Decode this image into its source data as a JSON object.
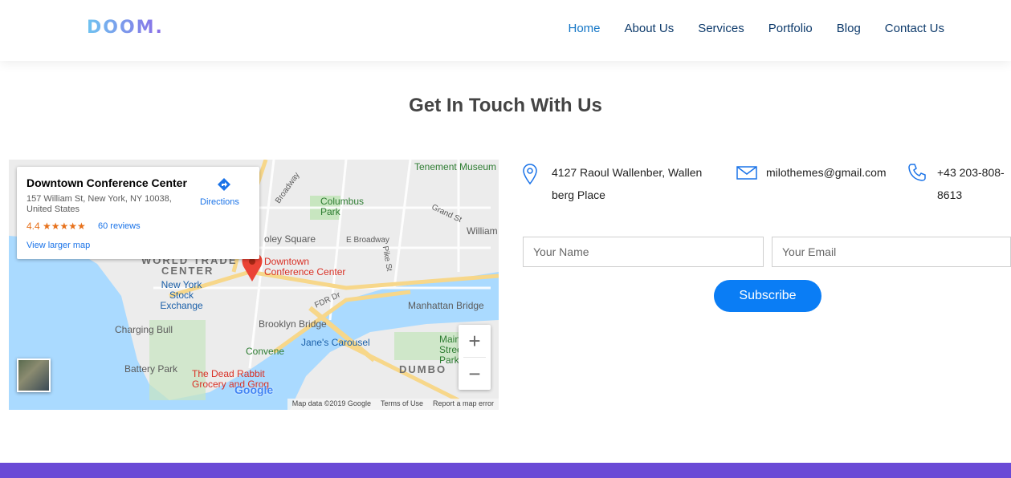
{
  "header": {
    "logo_text": "DOOM.",
    "nav": [
      {
        "label": "Home",
        "active": true
      },
      {
        "label": "About Us",
        "active": false
      },
      {
        "label": "Services",
        "active": false
      },
      {
        "label": "Portfolio",
        "active": false
      },
      {
        "label": "Blog",
        "active": false
      },
      {
        "label": "Contact Us",
        "active": false
      }
    ]
  },
  "section_title": "Get In Touch With Us",
  "map": {
    "card": {
      "name": "Downtown Conference Center",
      "address": "157 William St, New York, NY 10038, United States",
      "rating": "4.4 ★★★★★",
      "reviews": "60 reviews",
      "larger_map": "View larger map",
      "directions": "Directions"
    },
    "labels": {
      "tenement": "Tenement Museum",
      "columbus": "Columbus Park",
      "grand_st": "Grand St",
      "william": "William",
      "foley": "oley Square",
      "e_broadway": "E Broadway",
      "pike": "Pike St",
      "broadway": "Broadway",
      "world_trade": "WORLD TRADE",
      "center": "CENTER",
      "downtown": "Downtown Conference Center",
      "nyse": "New York Stock Exchange",
      "fdr": "FDR Dr",
      "manhattan_bridge": "Manhattan Bridge",
      "charging_bull": "Charging Bull",
      "brooklyn_bridge": "Brooklyn Bridge",
      "janes": "Jane's Carousel",
      "main_street": "Main Street Park",
      "convene": "Convene",
      "battery": "Battery Park",
      "dead_rabbit": "The Dead Rabbit Grocery and Grog",
      "dumbo": "DUMBO"
    },
    "zoom_in": "+",
    "zoom_out": "−",
    "google": "Google",
    "footer": [
      "Map data ©2019 Google",
      "Terms of Use",
      "Report a map error"
    ]
  },
  "contact": {
    "address_line1": "4127 Raoul Wallenber, Wallen",
    "address_line2": "berg Place",
    "email": "milothemes@gmail.com",
    "phone_line1": "+43 203-808-",
    "phone_line2": "8613"
  },
  "form": {
    "name_placeholder": "Your Name",
    "email_placeholder": "Your Email",
    "submit_label": "Subscribe"
  },
  "colors": {
    "accent": "#0a7df5",
    "nav_text": "#0d3a6b",
    "nav_active": "#1476c6",
    "band": "#6a4ad6"
  }
}
